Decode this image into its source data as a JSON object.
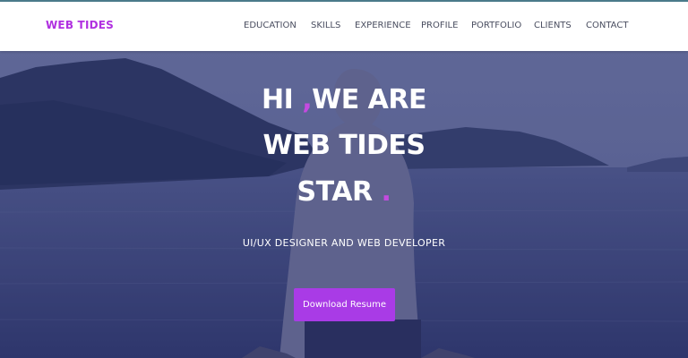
{
  "colors": {
    "accent": "#b030e0",
    "nav_text": "#4a4e60",
    "button_bg": "#a93be6"
  },
  "navbar": {
    "brand": "WEB TIDES",
    "links": [
      "EDUCATION",
      "SKILLS",
      "EXPERIENCE",
      "PROFILE",
      "PORTFOLIO",
      "CLIENTS",
      "CONTACT"
    ]
  },
  "hero": {
    "line1_a": "HI ",
    "line1_comma": ",",
    "line1_b": "WE ARE",
    "line2": "WEB TIDES",
    "line3": "STAR",
    "line3_dot": ".",
    "subtitle": "UI/UX DESIGNER AND WEB DEVELOPER",
    "cta_label": "Download Resume"
  }
}
